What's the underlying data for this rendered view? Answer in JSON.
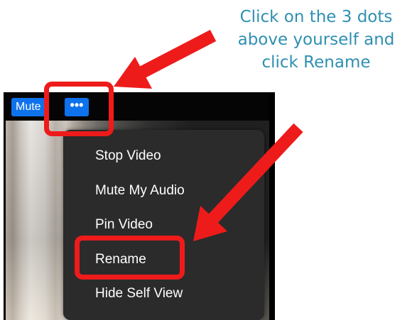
{
  "instruction": {
    "line1": "Click on the 3 dots",
    "line2": "above yourself and",
    "line3": "click Rename"
  },
  "video_tile": {
    "mute_label": "Mute",
    "more_label": "•••"
  },
  "menu": {
    "items": [
      {
        "label": "Stop Video"
      },
      {
        "label": "Mute My Audio"
      },
      {
        "label": "Pin Video"
      },
      {
        "label": "Rename"
      },
      {
        "label": "Hide Self View"
      }
    ]
  },
  "colors": {
    "annotation_red": "#ee1b1b",
    "instruction_text": "#2f8fb2",
    "zoom_blue": "#0e72ed",
    "menu_bg": "#2b2b2b"
  },
  "icons": [
    "three-dots-icon",
    "arrow-icon"
  ]
}
